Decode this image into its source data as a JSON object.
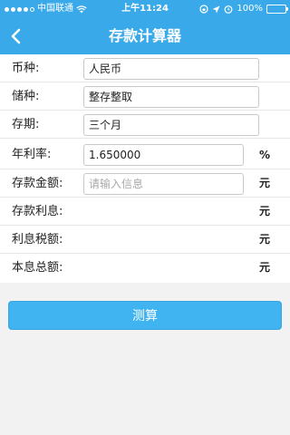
{
  "status_bar": {
    "carrier": "中国联通",
    "time": "上午11:24",
    "battery": "100%",
    "battery_level": 1.0,
    "signal_bars": 4
  },
  "nav": {
    "title": "存款计算器",
    "back_icon": "chevron-left-icon"
  },
  "form": {
    "currency": {
      "label": "币种:",
      "value": "人民币"
    },
    "deposit_type": {
      "label": "储种:",
      "value": "整存整取"
    },
    "term": {
      "label": "存期:",
      "value": "三个月"
    },
    "annual_rate": {
      "label": "年利率:",
      "value": "1.650000",
      "unit": "%"
    },
    "amount": {
      "label": "存款金额:",
      "placeholder": "请输入信息",
      "unit": "元"
    },
    "interest": {
      "label": "存款利息:",
      "unit": "元"
    },
    "interest_tax": {
      "label": "利息税额:",
      "unit": "元"
    },
    "total": {
      "label": "本息总额:",
      "unit": "元"
    }
  },
  "actions": {
    "calculate_label": "测算"
  },
  "colors": {
    "header": "#3aa9e9",
    "button": "#3fb4f1"
  }
}
